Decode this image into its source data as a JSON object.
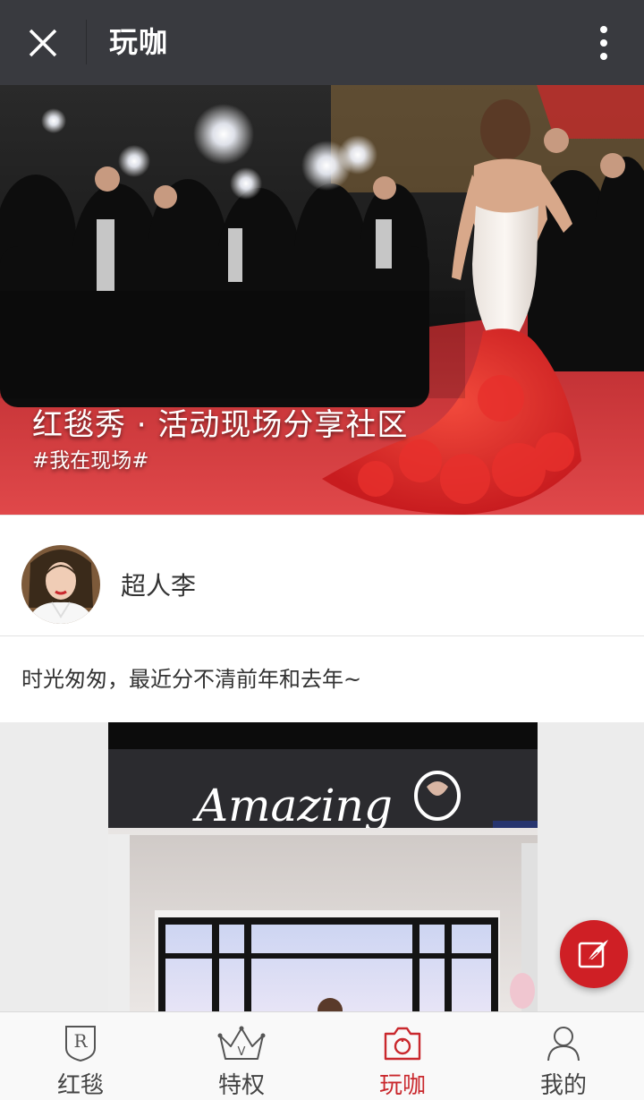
{
  "topbar": {
    "title": "玩咖",
    "close_icon": "close-icon",
    "more_icon": "more-vertical-icon"
  },
  "banner": {
    "headline": "红毯秀 · 活动现场分享社区",
    "hashtag": "#我在现场#",
    "slide_count": 2,
    "active_slide": 1
  },
  "post": {
    "author": "超人李",
    "text": "时光匆匆，最近分不清前年和去年~",
    "image_sign_text": "Amazing"
  },
  "fab": {
    "icon": "compose-icon",
    "color": "#cf1f25"
  },
  "tabs": [
    {
      "label": "红毯",
      "icon": "red-carpet-icon",
      "active": false
    },
    {
      "label": "特权",
      "icon": "crown-icon",
      "active": false
    },
    {
      "label": "玩咖",
      "icon": "camera-icon",
      "active": true
    },
    {
      "label": "我的",
      "icon": "profile-icon",
      "active": false
    }
  ],
  "colors": {
    "topbar_bg": "#393a3f",
    "accent": "#c9282d",
    "inactive_tab": "#444444"
  }
}
